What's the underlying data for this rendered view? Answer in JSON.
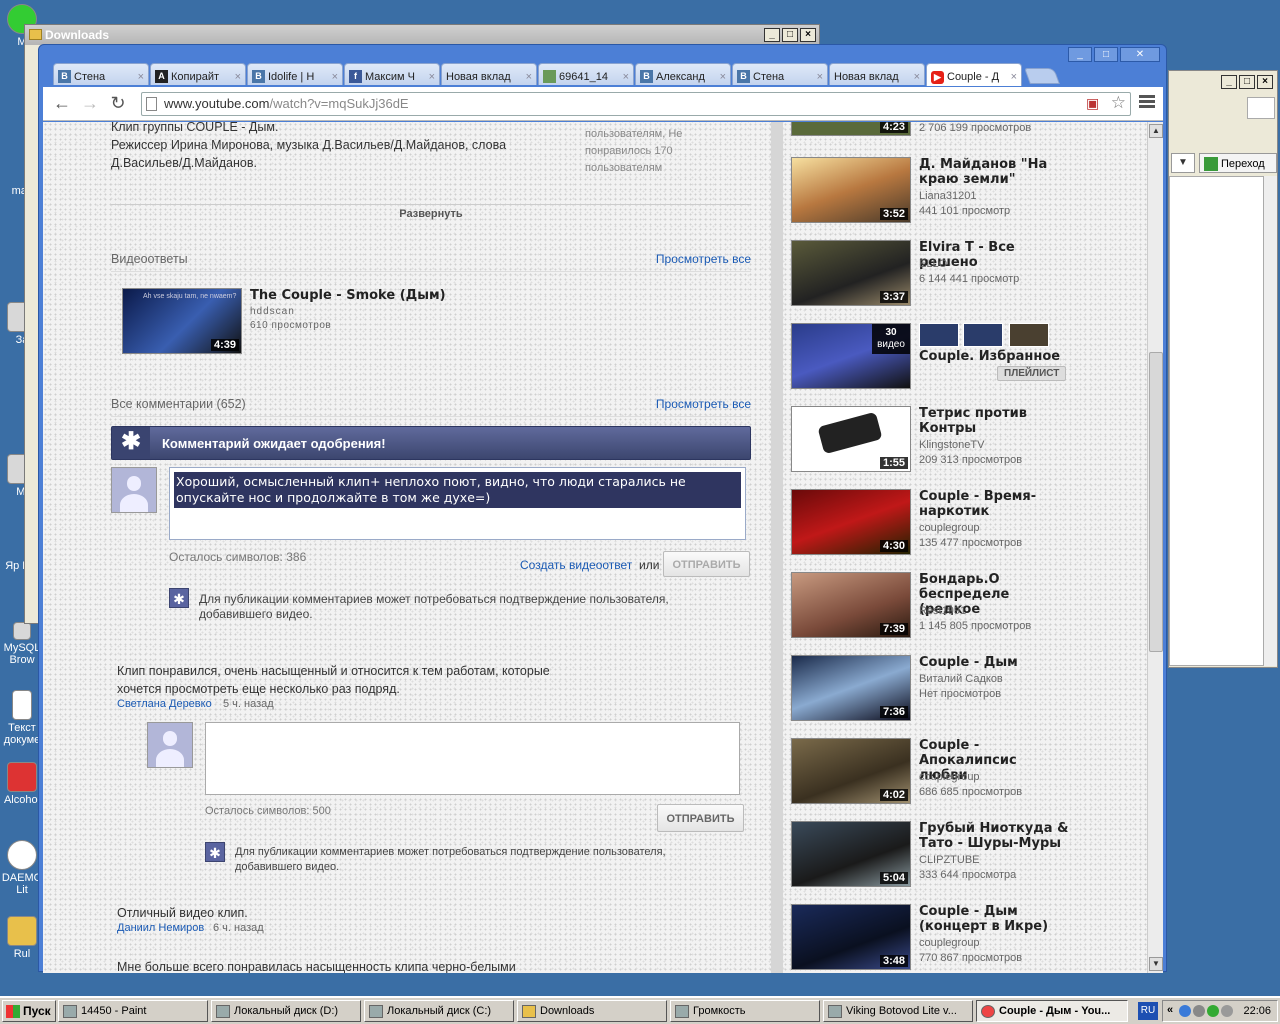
{
  "desktop": {
    "icons": [
      "M",
      "mac",
      "За",
      "",
      "Mi",
      "Яр DO",
      "MySQL Brow",
      "Текст докуме",
      "Alcohol",
      "DAEMO Lit",
      "Rul"
    ]
  },
  "downloads_window": {
    "title": "Downloads"
  },
  "right_window": {
    "go_label": "Переход"
  },
  "browser": {
    "tabs": [
      {
        "icon": "vk-icon",
        "label": "Стена"
      },
      {
        "icon": "a-icon",
        "label": "Копирайт"
      },
      {
        "icon": "vk-icon",
        "label": "Idolife | Н"
      },
      {
        "icon": "facebook-icon",
        "label": "Максим Ч"
      },
      {
        "icon": "",
        "label": "Новая вклад"
      },
      {
        "icon": "image-icon",
        "label": "69641_14"
      },
      {
        "icon": "vk-icon",
        "label": "Александ"
      },
      {
        "icon": "vk-icon",
        "label": "Стена"
      },
      {
        "icon": "",
        "label": "Новая вклад"
      },
      {
        "icon": "youtube-icon",
        "label": "Couple - Д"
      }
    ],
    "url_host": "www.youtube.com",
    "url_rest": "/watch?v=mqSukJj36dE"
  },
  "video_page": {
    "description": [
      "Клип группы COUPLE - Дым.",
      "Режиссер Ирина Миронова, музыка Д.Васильев/Д.Майданов, слова",
      "Д.Васильев/Д.Майданов."
    ],
    "stats": [
      "пользователям, Не",
      "понравилось 170",
      "пользователям"
    ],
    "expand_label": "Развернуть",
    "video_responses": {
      "heading": "Видеоответы",
      "see_all": "Просмотреть все",
      "item": {
        "title": "The Couple - Smoke (Дым)",
        "user": "hddscan",
        "views": "610 просмотров",
        "duration": "4:39",
        "thumb_caption": "Ah vse skaju tam, ne nwaem?"
      }
    },
    "comments": {
      "heading": "Все комментарии (652)",
      "see_all": "Просмотреть все",
      "pending_banner": "Комментарий ожидает одобрения!",
      "draft_text": "Хороший, осмысленный клип+ неплохо поют, видно, что люди старались не опускайте нос и продолжайте в том же духе=)",
      "chars_left": "Осталось символов: 386",
      "create_video_reply": "Создать видеоответ",
      "or": "или",
      "send": "ОТПРАВИТЬ",
      "note": "Для публикации комментариев может потребоваться подтверждение пользователя, добавившего видео.",
      "list": [
        {
          "text": "Клип понравился, очень насыщенный и относится к тем работам, которые хочется просмотреть еще несколько раз подряд.",
          "author": "Светлана Деревко",
          "time": "5 ч. назад"
        },
        {
          "text": "Отличный видео клип.",
          "author": "Даниил Немиров",
          "time": "6 ч. назад"
        },
        {
          "text": "Мне больше всего понравилась насыщенность клипа черно-белыми",
          "author": "",
          "time": ""
        }
      ],
      "reply_chars_left": "Осталось символов: 500",
      "reply_send": "ОТПРАВИТЬ",
      "reply_note": "Для публикации комментариев может потребоваться подтверждение пользователя, добавившего видео."
    },
    "related": [
      {
        "title": "",
        "channel": "",
        "views": "2 706 199 просмотров",
        "duration": "4:23"
      },
      {
        "title": "Д. Майданов \"На краю земли\"",
        "channel": "Liana31201",
        "views": "441 101 просмотр",
        "duration": "3:52"
      },
      {
        "title": "Elvira T - Все решено",
        "channel": "ELLO",
        "views": "6 144 441 просмотр",
        "duration": "3:37"
      },
      {
        "title": "Couple. Избранное",
        "channel": "",
        "views": "",
        "duration": "",
        "playlist_count": "30",
        "playlist_word": "видео",
        "playlist_badge": "ПЛЕЙЛИСТ"
      },
      {
        "title": "Тетрис против Контры",
        "channel": "KlingstoneTV",
        "views": "209 313 просмотров",
        "duration": "1:55"
      },
      {
        "title": "Couple - Время-наркотик",
        "channel": "couplegroup",
        "views": "135 477 просмотров",
        "duration": "4:30"
      },
      {
        "title": "Бондарь.О беспределе (редкое",
        "channel": "Rest1991",
        "views": "1 145 805 просмотров",
        "duration": "7:39"
      },
      {
        "title": "Couple - Дым",
        "channel": "Виталий Садков",
        "views": "Нет просмотров",
        "duration": "7:36"
      },
      {
        "title": "Couple - Апокалипсис любви",
        "channel": "couplegroup",
        "views": "686 685 просмотров",
        "duration": "4:02"
      },
      {
        "title": "Грубый Ниоткуда & Тато - Шуры-Муры",
        "channel": "CLIPZTUBE",
        "views": "333 644 просмотра",
        "duration": "5:04"
      },
      {
        "title": "Couple - Дым (концерт в Икре)",
        "channel": "couplegroup",
        "views": "770 867 просмотров",
        "duration": "3:48"
      }
    ]
  },
  "taskbar": {
    "start": "Пуск",
    "items": [
      "14450 - Paint",
      "Локальный диск (D:)",
      "Локальный диск (C:)",
      "Downloads",
      "Громкость",
      "Viking Botovod Lite    v...",
      "Couple - Дым - You..."
    ],
    "lang": "RU",
    "clock": "22:06"
  }
}
